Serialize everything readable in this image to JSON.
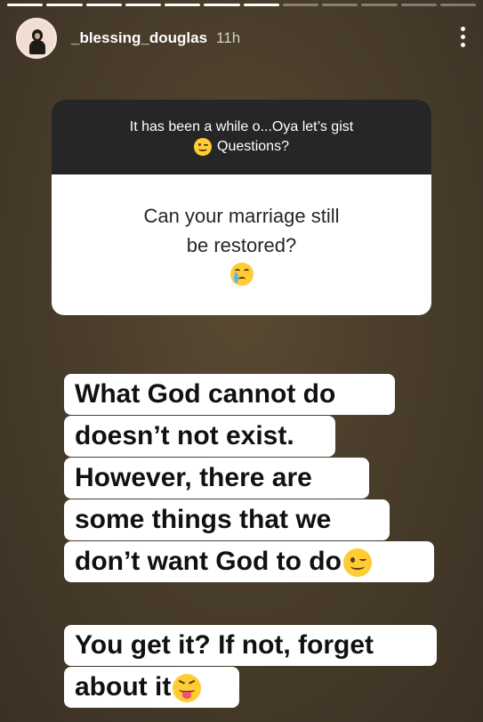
{
  "progress": {
    "total": 12,
    "completed": 7
  },
  "header": {
    "username": "_blessing_douglas",
    "time": "11h"
  },
  "question_box": {
    "prompt_line1": "It has been a while o...Oya let’s gist",
    "prompt_line2": "Questions?",
    "question_line1": "Can your marriage still",
    "question_line2": "be restored?"
  },
  "answer1": {
    "line1": "What God cannot do",
    "line2": "doesn’t not exist.",
    "line3": "However, there are",
    "line4": "some things that we",
    "line5": "don’t want God to do"
  },
  "answer2": {
    "line1": "You get it? If not, forget",
    "line2": "about it"
  },
  "icons": {
    "wink": "winking-face-emoji",
    "cry": "crying-face-emoji",
    "tongue": "squinting-face-with-tongue-emoji"
  },
  "colors": {
    "question_header_bg": "#262626",
    "emoji_yellow": "#ffcc33"
  }
}
